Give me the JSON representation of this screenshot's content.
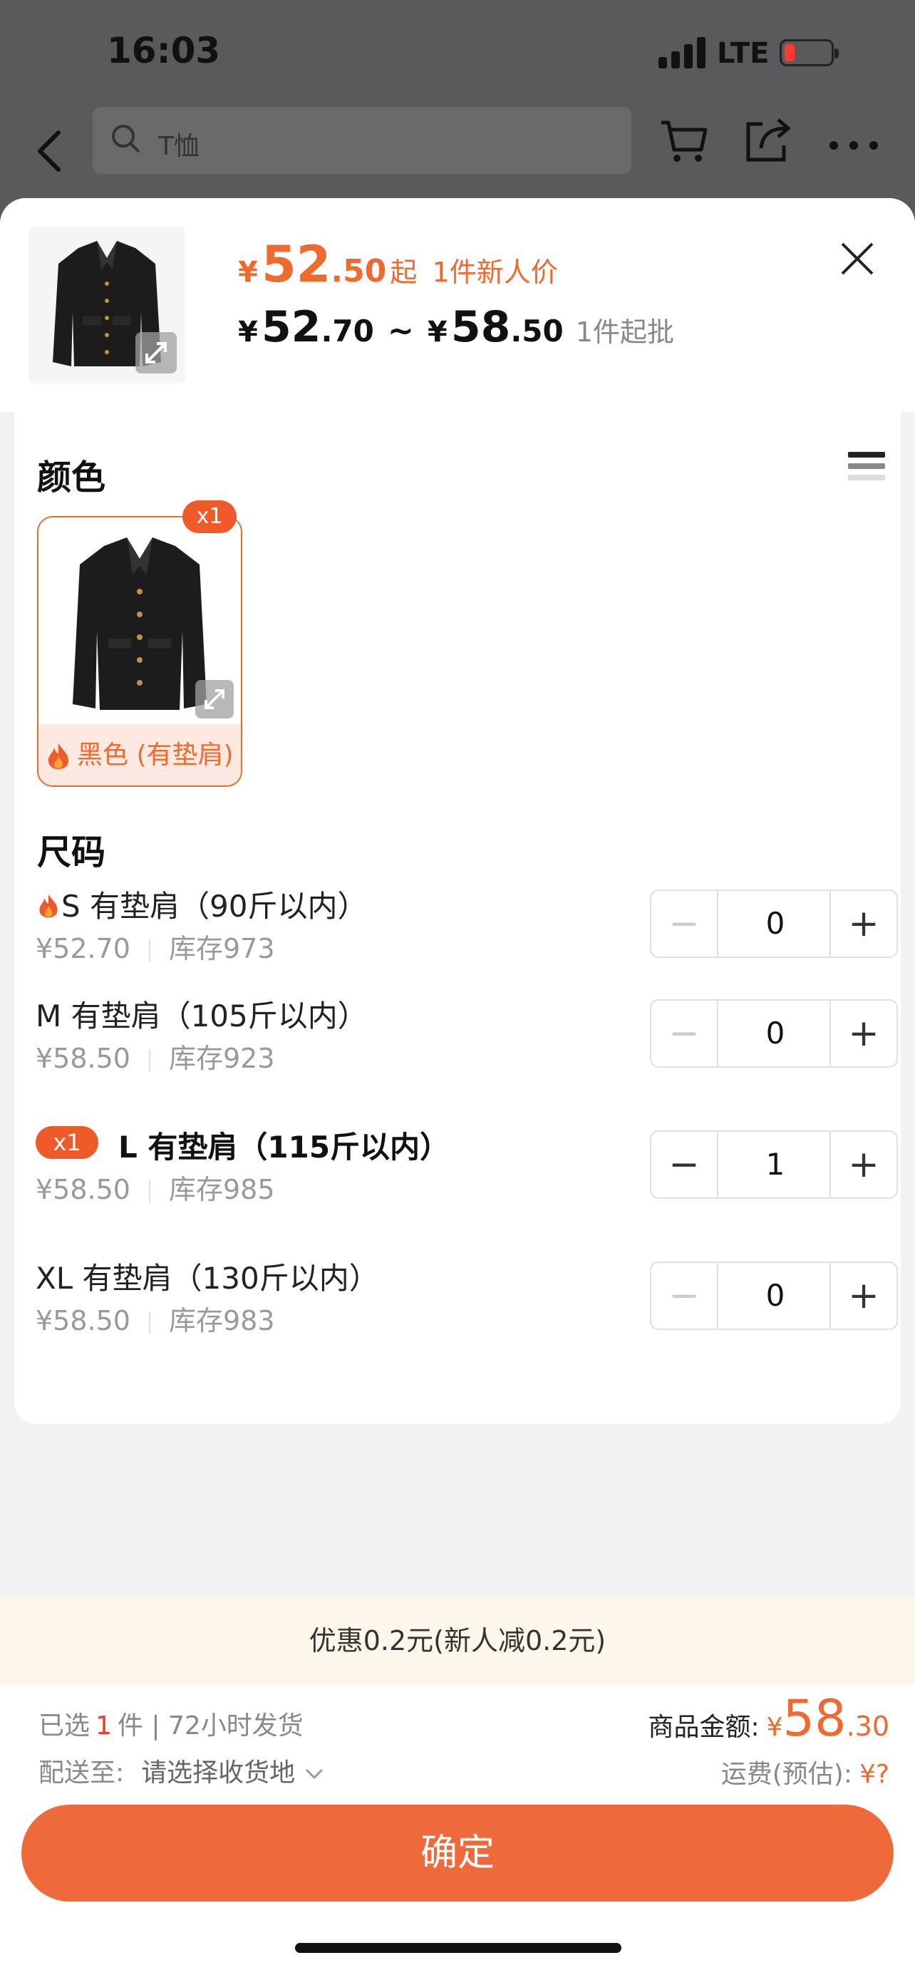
{
  "status_bar": {
    "time": "16:03",
    "network": "LTE"
  },
  "nav": {
    "search_placeholder": "T恤"
  },
  "product": {
    "promo_price": {
      "currency": "¥",
      "int": "52",
      "dec": ".50",
      "suffix": "起",
      "note": "1件新人价"
    },
    "range": {
      "currency1": "¥",
      "int1": "52",
      "dec1": ".70",
      "sep": "~",
      "currency2": "¥",
      "int2": "58",
      "dec2": ".50",
      "min_order": "1件起批"
    }
  },
  "color_section": {
    "title": "颜色",
    "option": {
      "label": "黑色 (有垫肩)",
      "badge": "x1"
    }
  },
  "size_section": {
    "title": "尺码",
    "rows": [
      {
        "name": "S 有垫肩（90斤以内）",
        "price": "¥52.70",
        "stock": "库存973",
        "qty": "0"
      },
      {
        "name": "M 有垫肩（105斤以内）",
        "price": "¥58.50",
        "stock": "库存923",
        "qty": "0"
      },
      {
        "name": "L 有垫肩（115斤以内）",
        "price": "¥58.50",
        "stock": "库存985",
        "qty": "1",
        "badge": "x1"
      },
      {
        "name": "XL 有垫肩（130斤以内）",
        "price": "¥58.50",
        "stock": "库存983",
        "qty": "0"
      }
    ]
  },
  "promo_bar": "优惠0.2元(新人减0.2元)",
  "footer": {
    "selected_prefix": "已选",
    "selected_count": "1",
    "selected_suffix": "件 | 72小时发货",
    "deliver_label": "配送至:",
    "deliver_value": "请选择收货地",
    "amount_label": "商品金额:",
    "amount_currency": "¥",
    "amount_int": "58",
    "amount_dec": ".30",
    "shipping_label": "运费(预估):",
    "shipping_value": "¥?",
    "confirm_label": "确定"
  },
  "colors": {
    "accent": "#ef6a3a",
    "badge": "#ef5a2a",
    "promo_bg": "#fdf6ea"
  }
}
